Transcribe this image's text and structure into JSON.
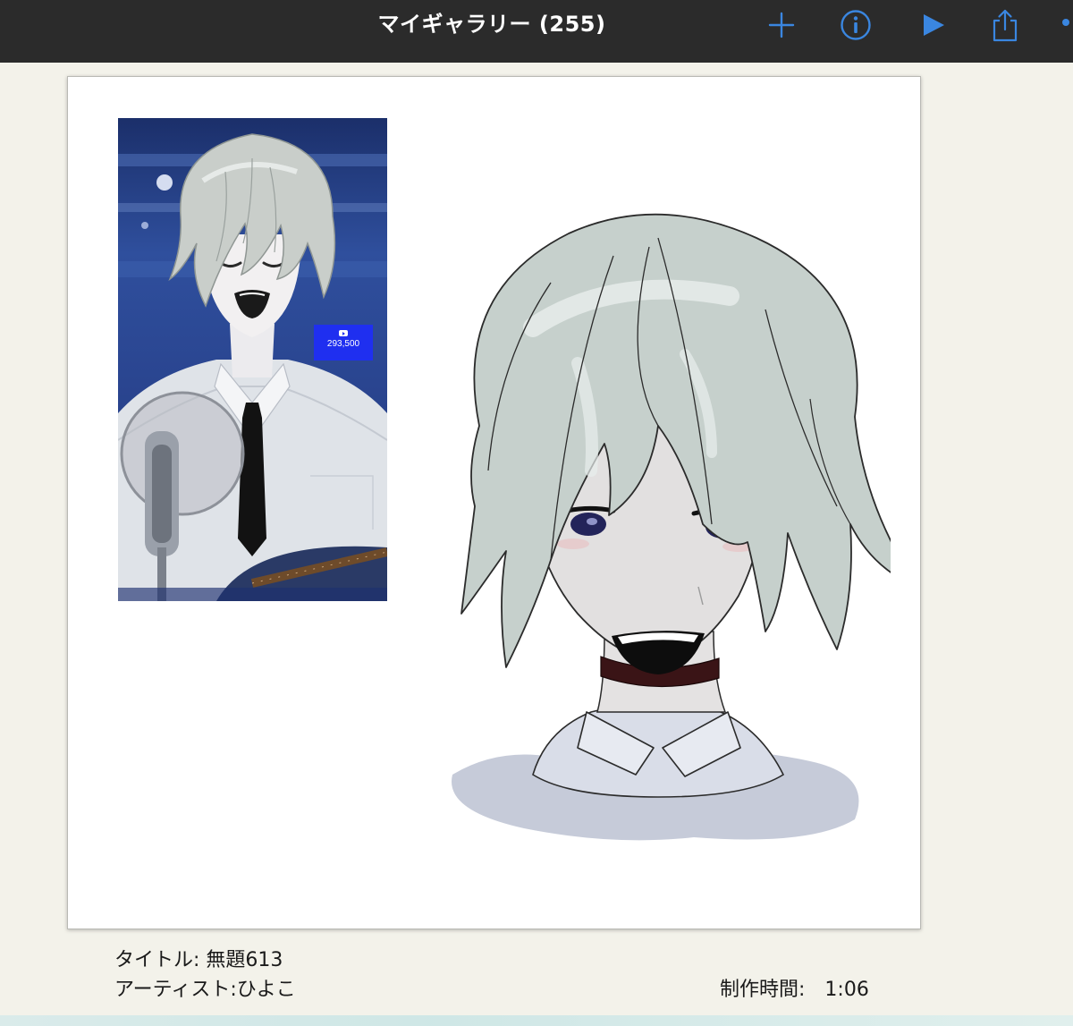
{
  "header": {
    "title": "マイギャラリー (255)",
    "accent_color": "#3a86e0",
    "background_color": "#2b2b2b",
    "buttons": [
      {
        "id": "add",
        "icon": "plus-icon"
      },
      {
        "id": "info",
        "icon": "info-icon"
      },
      {
        "id": "play",
        "icon": "play-icon"
      },
      {
        "id": "share",
        "icon": "share-icon"
      }
    ]
  },
  "artwork": {
    "reference": {
      "subscriber_count": "293,500",
      "badge_color": "#1f2ff0",
      "badge_icon": "youtube-icon"
    }
  },
  "info": {
    "title_label": "タイトル: ",
    "title_value": "無題613",
    "artist_label": "アーティスト:",
    "artist_value": "ひよこ",
    "time_label": "制作時間:",
    "time_value": "1:06"
  }
}
